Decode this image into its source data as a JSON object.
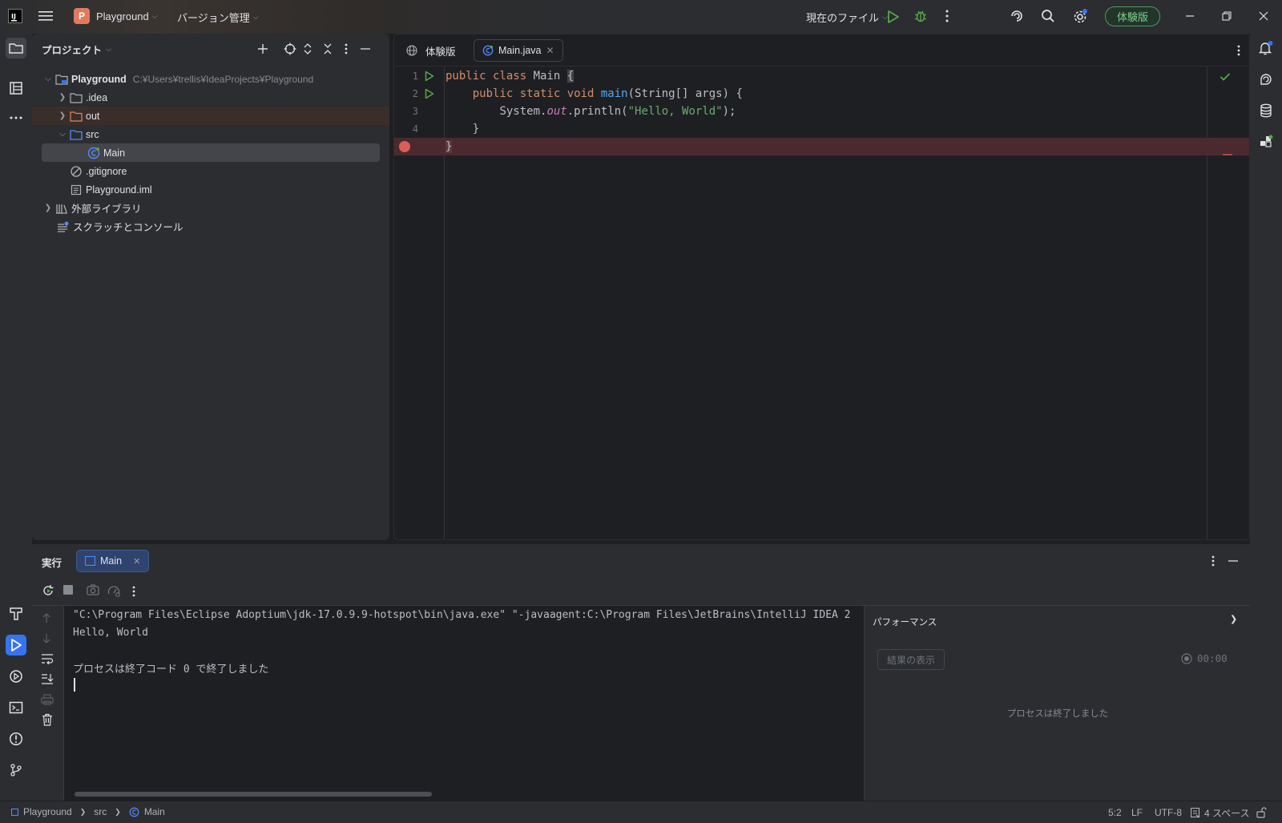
{
  "titlebar": {
    "project_name": "Playground",
    "project_initial": "P",
    "vcs_menu": "バージョン管理",
    "run_config": "現在のファイル",
    "trial_button": "体験版"
  },
  "project_panel": {
    "title": "プロジェクト",
    "root": {
      "name": "Playground",
      "path": "C:¥Users¥trellis¥IdeaProjects¥Playground"
    },
    "items": [
      {
        "name": ".idea",
        "type": "folder",
        "expanded": false
      },
      {
        "name": "out",
        "type": "folder-excluded",
        "expanded": false
      },
      {
        "name": "src",
        "type": "folder-source",
        "expanded": true
      },
      {
        "name": "Main",
        "type": "java-class",
        "selected": true
      },
      {
        "name": ".gitignore",
        "type": "ignore-file"
      },
      {
        "name": "Playground.iml",
        "type": "iml-file"
      },
      {
        "name": "外部ライブラリ",
        "type": "libraries",
        "expanded": false
      },
      {
        "name": "スクラッチとコンソール",
        "type": "scratches"
      }
    ]
  },
  "editor": {
    "tabs": [
      {
        "label": "体験版",
        "icon": "globe-icon"
      },
      {
        "label": "Main.java",
        "icon": "java-class-icon",
        "active": true
      }
    ],
    "line_numbers": [
      "1",
      "2",
      "3",
      "4",
      ""
    ],
    "code": {
      "l1_kw": "public class ",
      "l1_name": "Main ",
      "l1_brace": "{",
      "l2_indent": "    ",
      "l2_kw": "public static void ",
      "l2_fn": "main",
      "l2_rest": "(String[] args) {",
      "l3_indent": "        ",
      "l3_a": "System.",
      "l3_out": "out",
      "l3_b": ".println(",
      "l3_str": "\"Hello, World\"",
      "l3_c": ");",
      "l4": "    }",
      "l5": "}"
    }
  },
  "run_panel": {
    "title": "実行",
    "tab_label": "Main",
    "console": [
      "\"C:\\Program Files\\Eclipse Adoptium\\jdk-17.0.9.9-hotspot\\bin\\java.exe\" \"-javaagent:C:\\Program Files\\JetBrains\\IntelliJ IDEA 2",
      "Hello, World",
      "",
      "プロセスは終了コード 0 で終了しました"
    ],
    "performance": {
      "title": "パフォーマンス",
      "show_results_button": "結果の表示",
      "timer": "00:00",
      "status": "プロセスは終了しました"
    }
  },
  "statusbar": {
    "breadcrumb": [
      "Playground",
      "src",
      "Main"
    ],
    "position": "5:2",
    "line_separator": "LF",
    "encoding": "UTF-8",
    "indent": "4 スペース"
  },
  "colors": {
    "accent": "#3574f0",
    "breakpoint": "#db5c5c",
    "error_line_bg": "#4a2a2f",
    "trial_green": "#7fd08d"
  }
}
